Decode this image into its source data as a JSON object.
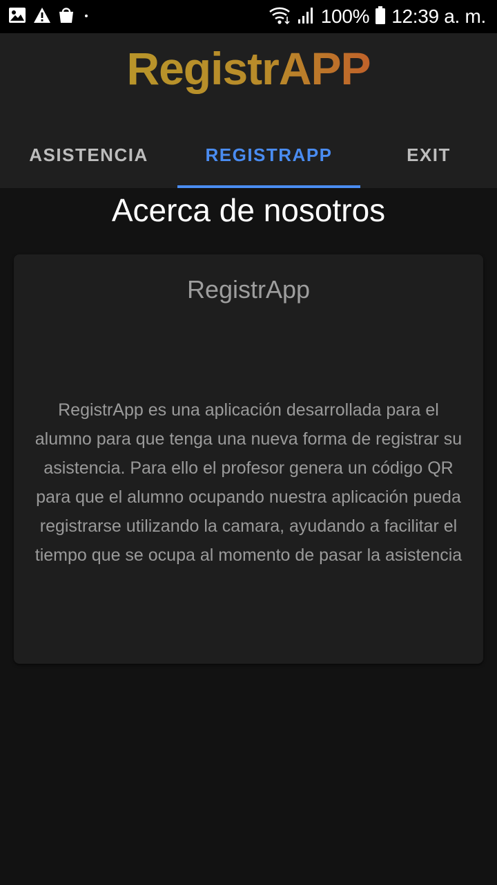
{
  "status_bar": {
    "battery": "100%",
    "time": "12:39 a. m.",
    "icons_left": [
      "image-icon",
      "warning-icon",
      "shopping-bag-icon",
      "dot-icon"
    ],
    "icons_right": [
      "wifi-icon",
      "signal-icon",
      "battery-icon"
    ]
  },
  "header": {
    "logo_text": "RegistrAPP",
    "logo_part1": "Registr",
    "logo_part2": "APP",
    "logo_colors": [
      "#b8952a",
      "#c0652a"
    ]
  },
  "tabs": [
    {
      "label": "ASISTENCIA",
      "active": false
    },
    {
      "label": "REGISTRAPP",
      "active": true
    },
    {
      "label": "EXIT",
      "active": false
    }
  ],
  "accent_color": "#4a8cf1",
  "page": {
    "title": "Acerca de nosotros"
  },
  "card": {
    "title": "RegistrApp",
    "body": "RegistrApp es una aplicación desarrollada para el alumno para que tenga una nueva forma de registrar su asistencia. Para ello el profesor genera un código QR para que el alumno ocupando nuestra aplicación pueda registrarse utilizando la camara, ayudando a facilitar el tiempo que se ocupa al momento de pasar la asistencia"
  }
}
